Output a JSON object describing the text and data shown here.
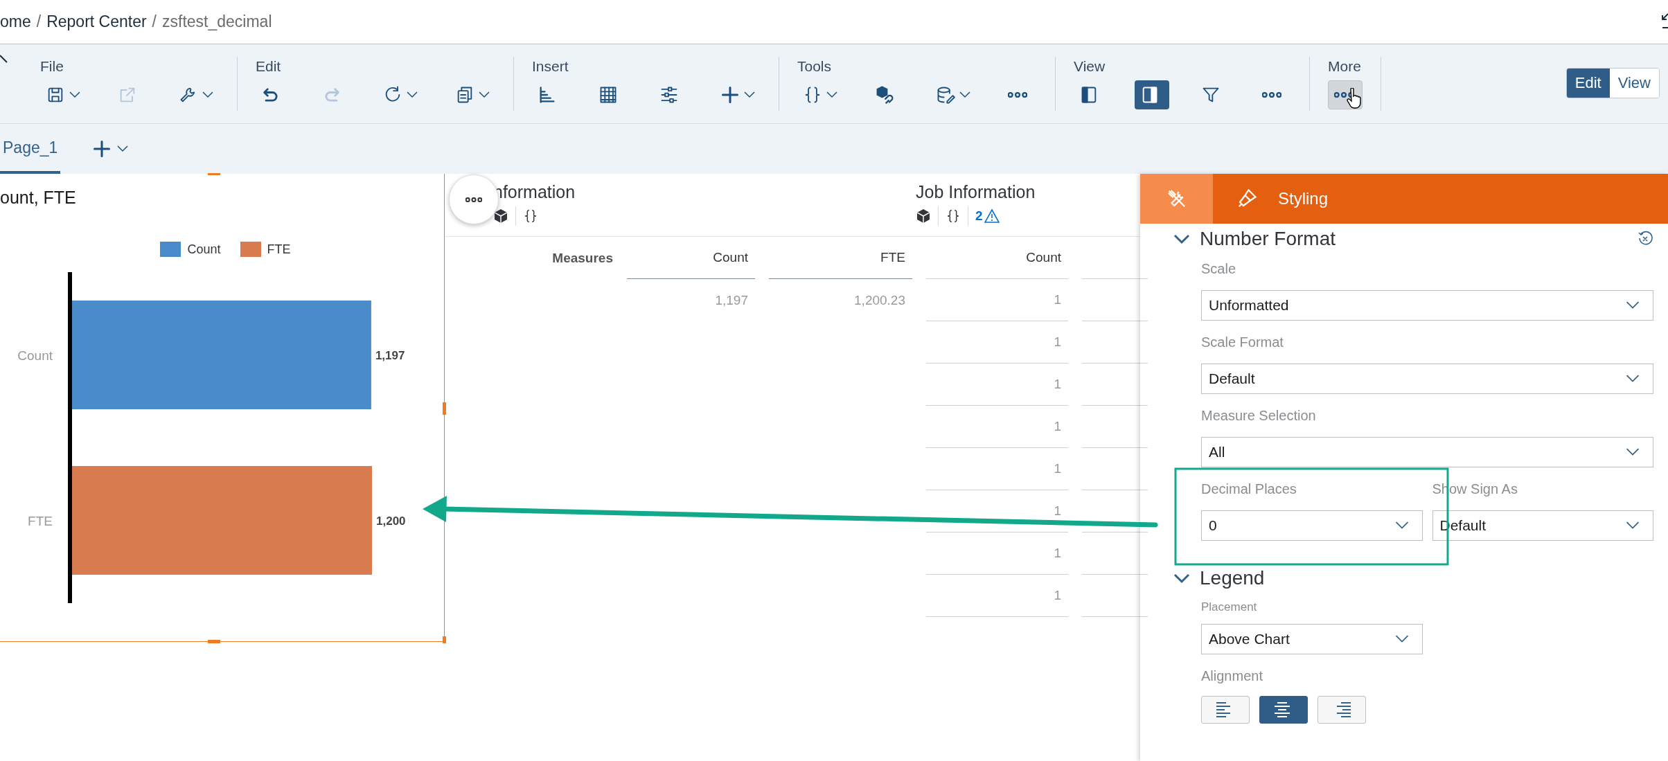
{
  "breadcrumb": {
    "separator": "/",
    "items": [
      {
        "label": "ome",
        "current": false
      },
      {
        "label": "Report Center",
        "current": false
      },
      {
        "label": "zsftest_decimal",
        "current": true
      }
    ]
  },
  "toolbar": {
    "groups": [
      {
        "label": "File",
        "items": [
          {
            "caret": true,
            "disabled": false,
            "selected": false,
            "hovered": false
          },
          {
            "caret": false,
            "disabled": true,
            "selected": false,
            "hovered": false
          },
          {
            "caret": true,
            "disabled": false,
            "selected": false,
            "hovered": false
          }
        ]
      },
      {
        "label": "Edit",
        "items": [
          {
            "caret": false,
            "disabled": false,
            "selected": false,
            "hovered": false
          },
          {
            "caret": false,
            "disabled": true,
            "selected": false,
            "hovered": false
          },
          {
            "caret": true,
            "disabled": false,
            "selected": false,
            "hovered": false
          },
          {
            "caret": true,
            "disabled": false,
            "selected": false,
            "hovered": false
          }
        ]
      },
      {
        "label": "Insert",
        "items": [
          {
            "caret": false,
            "disabled": false,
            "selected": false,
            "hovered": false
          },
          {
            "caret": false,
            "disabled": false,
            "selected": false,
            "hovered": false
          },
          {
            "caret": false,
            "disabled": false,
            "selected": false,
            "hovered": false
          },
          {
            "caret": true,
            "disabled": false,
            "selected": false,
            "hovered": false
          }
        ]
      },
      {
        "label": "Tools",
        "items": [
          {
            "caret": true,
            "disabled": false,
            "selected": false,
            "hovered": false
          },
          {
            "caret": false,
            "disabled": false,
            "selected": false,
            "hovered": false
          },
          {
            "caret": true,
            "disabled": false,
            "selected": false,
            "hovered": false
          },
          {
            "caret": false,
            "disabled": false,
            "selected": false,
            "hovered": false
          }
        ]
      },
      {
        "label": "View",
        "items": [
          {
            "caret": false,
            "disabled": false,
            "selected": false,
            "hovered": false
          },
          {
            "caret": false,
            "disabled": false,
            "selected": true,
            "hovered": false
          },
          {
            "caret": false,
            "disabled": false,
            "selected": false,
            "hovered": false
          },
          {
            "caret": false,
            "disabled": false,
            "selected": false,
            "hovered": false
          }
        ]
      },
      {
        "label": "More",
        "items": [
          {
            "caret": false,
            "disabled": false,
            "selected": false,
            "hovered": true
          }
        ]
      }
    ],
    "mode_toggle": [
      {
        "label": "Edit",
        "selected": true
      },
      {
        "label": "View",
        "selected": false
      }
    ]
  },
  "pages": {
    "tabs": [
      {
        "label": "Page_1",
        "selected": true
      }
    ]
  },
  "chart_widget": {
    "title": "ount, FTE",
    "chart_data": {
      "type": "bar",
      "orientation": "horizontal",
      "categories": [
        "Count",
        "FTE"
      ],
      "series": [
        {
          "name": "Count",
          "color": "#4a8bc9",
          "values": [
            1197,
            null
          ],
          "value_labels": [
            "1,197",
            null
          ]
        },
        {
          "name": "FTE",
          "color": "#d87c50",
          "values": [
            null,
            1200
          ],
          "value_labels": [
            null,
            "1,200"
          ]
        }
      ],
      "data_labels": true
    }
  },
  "table_widget": {
    "headers": [
      {
        "title": "nformation"
      },
      {
        "title": "Job Information",
        "warning_count": "2"
      }
    ],
    "columns": [
      "Measures",
      "Count",
      "FTE",
      "Count"
    ],
    "rows": [
      {
        "count": "1,197",
        "fte": "1,200.23",
        "job_count": "1"
      },
      {
        "job_count": "1"
      },
      {
        "job_count": "1"
      },
      {
        "job_count": "1"
      },
      {
        "job_count": "1"
      },
      {
        "job_count": "1"
      },
      {
        "job_count": "1"
      },
      {
        "job_count": "1"
      }
    ]
  },
  "side_panel": {
    "tabs": [
      {
        "kind": "builder",
        "selected": false
      },
      {
        "kind": "styling",
        "label": "Styling",
        "selected": true
      }
    ],
    "sections": [
      {
        "title": "Number Format",
        "expanded": true,
        "resettable": true,
        "rows": [
          [
            {
              "kind": "dropdown",
              "label": "Scale",
              "value": "Unformatted"
            }
          ],
          [
            {
              "kind": "dropdown",
              "label": "Scale Format",
              "value": "Default"
            }
          ],
          [
            {
              "kind": "dropdown",
              "label": "Measure Selection",
              "value": "All"
            }
          ],
          [
            {
              "kind": "dropdown",
              "label": "Decimal Places",
              "value": "0"
            },
            {
              "kind": "dropdown",
              "label": "Show Sign As",
              "value": "Default"
            }
          ]
        ]
      },
      {
        "title": "Legend",
        "expanded": true,
        "resettable": false,
        "rows": [
          [
            {
              "kind": "compact_dropdown",
              "label": "Placement",
              "value": "Above Chart"
            }
          ],
          [
            {
              "kind": "alignment",
              "label": "Alignment",
              "options": [
                {
                  "selected": false
                },
                {
                  "selected": true
                },
                {
                  "selected": false
                }
              ]
            }
          ]
        ]
      }
    ]
  }
}
